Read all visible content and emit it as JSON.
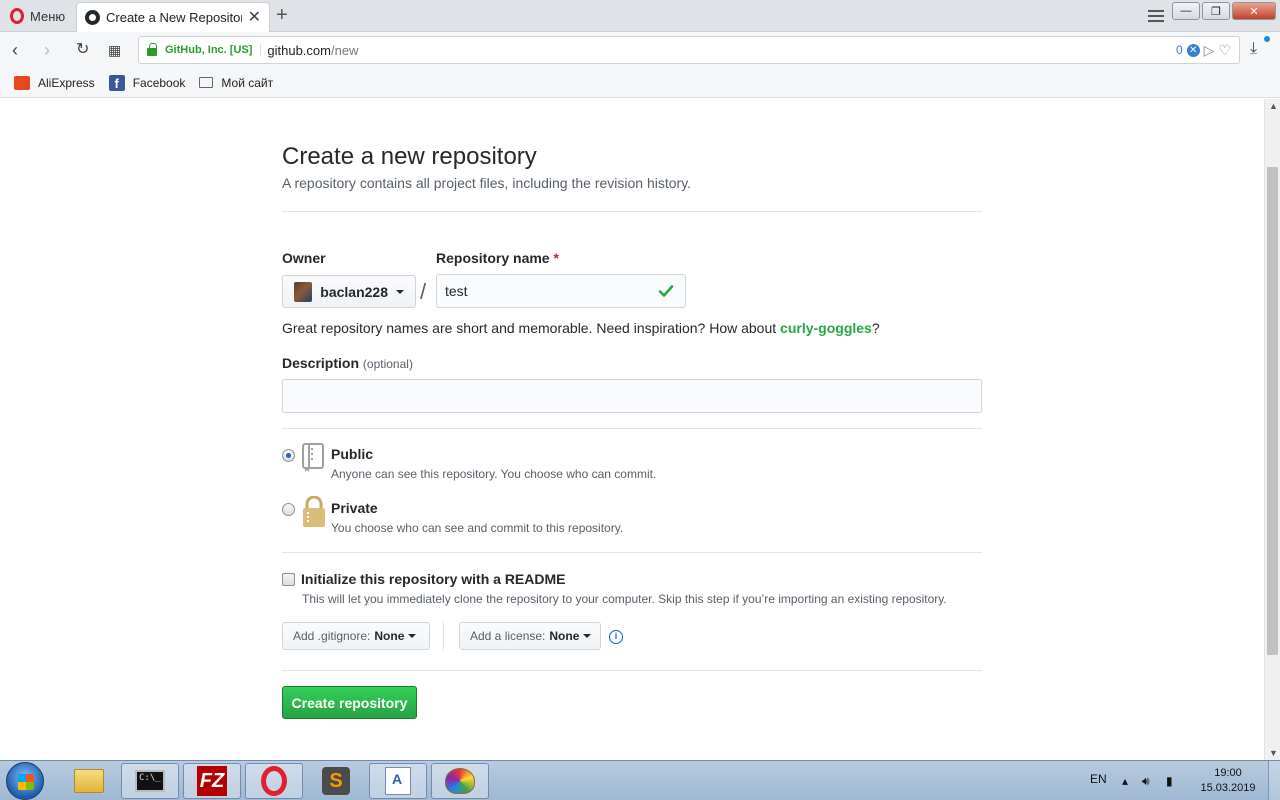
{
  "browser": {
    "menu_label": "Меню",
    "tab_title": "Create a New Repository",
    "ev_label": "GitHub, Inc. [US]",
    "url_host": "github.com",
    "url_path": "/new",
    "badge_count": "0",
    "bookmarks": [
      {
        "label": "AliExpress",
        "icon": "aliexpress-icon"
      },
      {
        "label": "Facebook",
        "icon": "facebook-icon"
      },
      {
        "label": "Мой сайт",
        "icon": "folder-icon"
      }
    ]
  },
  "page": {
    "title": "Create a new repository",
    "subtitle": "A repository contains all project files, including the revision history.",
    "owner_label": "Owner",
    "owner_value": "baclan228",
    "repo_label": "Repository name",
    "required_mark": "*",
    "repo_value": "test",
    "hint_text": "Great repository names are short and memorable. Need inspiration? How about ",
    "hint_suggestion": "curly-goggles",
    "hint_end": "?",
    "description_label": "Description",
    "description_optional": "(optional)",
    "description_value": "",
    "visibility": [
      {
        "title": "Public",
        "desc": "Anyone can see this repository. You choose who can commit.",
        "selected": true
      },
      {
        "title": "Private",
        "desc": "You choose who can see and commit to this repository.",
        "selected": false
      }
    ],
    "readme_label": "Initialize this repository with a README",
    "readme_desc": "This will let you immediately clone the repository to your computer. Skip this step if you’re importing an existing repository.",
    "readme_checked": false,
    "gitignore_prefix": "Add .gitignore:",
    "gitignore_value": "None",
    "license_prefix": "Add a license:",
    "license_value": "None",
    "create_button": "Create repository",
    "accent_green": "#28a745",
    "link_blue": "#0366d6"
  },
  "taskbar": {
    "apps": [
      "explorer-icon",
      "cmd-icon",
      "filezilla-icon",
      "opera-icon",
      "sublime-icon",
      "wordpad-icon",
      "paint-icon"
    ],
    "active_app": "opera-icon",
    "cmd_text": "C:\\_",
    "filezilla_text": "FZ",
    "sublime_text": "S",
    "language": "EN",
    "time": "19:00",
    "date": "15.03.2019"
  }
}
